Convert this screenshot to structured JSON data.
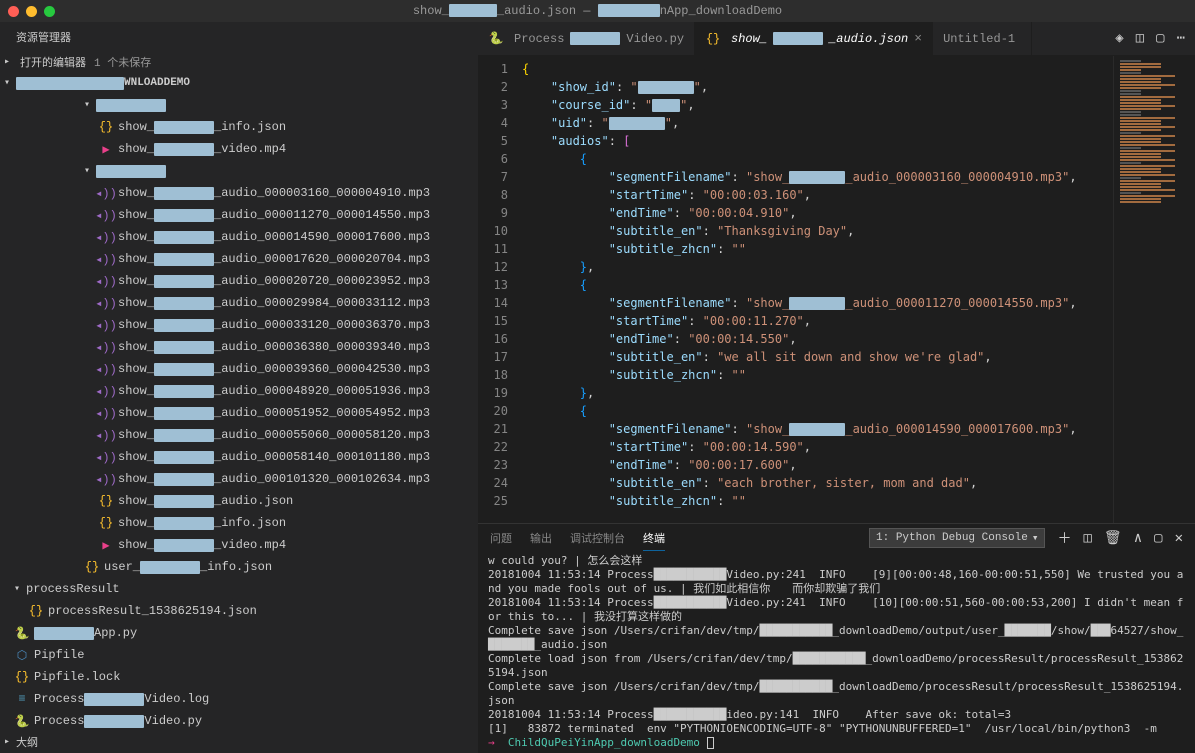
{
  "window": {
    "title_prefix": "show_",
    "title_mid": "_audio.json — ",
    "title_suffix": "nApp_downloadDemo"
  },
  "sidebar": {
    "title": "资源管理器",
    "open_editors_label": "打开的编辑器",
    "unsaved_count": "1 个未保存",
    "project_suffix": "WNLOADDEMO",
    "outline_label": "大纲"
  },
  "tree": {
    "items": [
      {
        "type": "folder",
        "indent": 1,
        "open": true,
        "label": ""
      },
      {
        "type": "file",
        "indent": 2,
        "icon": "json",
        "prefix": "show_",
        "suffix": "_info.json"
      },
      {
        "type": "file",
        "indent": 2,
        "icon": "video",
        "prefix": "show_",
        "suffix": "_video.mp4"
      },
      {
        "type": "folder",
        "indent": 1,
        "open": true,
        "label": ""
      },
      {
        "type": "file",
        "indent": 2,
        "icon": "audio",
        "prefix": "show_",
        "suffix": "_audio_000003160_000004910.mp3"
      },
      {
        "type": "file",
        "indent": 2,
        "icon": "audio",
        "prefix": "show_",
        "suffix": "_audio_000011270_000014550.mp3"
      },
      {
        "type": "file",
        "indent": 2,
        "icon": "audio",
        "prefix": "show_",
        "suffix": "_audio_000014590_000017600.mp3"
      },
      {
        "type": "file",
        "indent": 2,
        "icon": "audio",
        "prefix": "show_",
        "suffix": "_audio_000017620_000020704.mp3"
      },
      {
        "type": "file",
        "indent": 2,
        "icon": "audio",
        "prefix": "show_",
        "suffix": "_audio_000020720_000023952.mp3"
      },
      {
        "type": "file",
        "indent": 2,
        "icon": "audio",
        "prefix": "show_",
        "suffix": "_audio_000029984_000033112.mp3"
      },
      {
        "type": "file",
        "indent": 2,
        "icon": "audio",
        "prefix": "show_",
        "suffix": "_audio_000033120_000036370.mp3"
      },
      {
        "type": "file",
        "indent": 2,
        "icon": "audio",
        "prefix": "show_",
        "suffix": "_audio_000036380_000039340.mp3"
      },
      {
        "type": "file",
        "indent": 2,
        "icon": "audio",
        "prefix": "show_",
        "suffix": "_audio_000039360_000042530.mp3"
      },
      {
        "type": "file",
        "indent": 2,
        "icon": "audio",
        "prefix": "show_",
        "suffix": "_audio_000048920_000051936.mp3"
      },
      {
        "type": "file",
        "indent": 2,
        "icon": "audio",
        "prefix": "show_",
        "suffix": "_audio_000051952_000054952.mp3"
      },
      {
        "type": "file",
        "indent": 2,
        "icon": "audio",
        "prefix": "show_",
        "suffix": "_audio_000055060_000058120.mp3"
      },
      {
        "type": "file",
        "indent": 2,
        "icon": "audio",
        "prefix": "show_",
        "suffix": "_audio_000058140_000101180.mp3"
      },
      {
        "type": "file",
        "indent": 2,
        "icon": "audio",
        "prefix": "show_",
        "suffix": "_audio_000101320_000102634.mp3"
      },
      {
        "type": "file",
        "indent": 2,
        "icon": "json",
        "prefix": "show_",
        "suffix": "_audio.json"
      },
      {
        "type": "file",
        "indent": 2,
        "icon": "json",
        "prefix": "show_",
        "suffix": "_info.json"
      },
      {
        "type": "file",
        "indent": 2,
        "icon": "video",
        "prefix": "show_",
        "suffix": "_video.mp4"
      },
      {
        "type": "file",
        "indent": 1,
        "icon": "json",
        "prefix": "user_",
        "suffix": "_info.json"
      }
    ],
    "bottom": [
      {
        "type": "folder",
        "indent": 0,
        "open": true,
        "label": "processResult"
      },
      {
        "type": "file",
        "indent": 1,
        "icon": "json",
        "label": "processResult_1538625194.json"
      },
      {
        "type": "file",
        "indent": 0,
        "icon": "py",
        "suffix": "App.py",
        "redact": true
      },
      {
        "type": "file",
        "indent": 0,
        "icon": "pip",
        "label": "Pipfile"
      },
      {
        "type": "file",
        "indent": 0,
        "icon": "lock",
        "label": "Pipfile.lock"
      },
      {
        "type": "file",
        "indent": 0,
        "icon": "log",
        "prefix": "Process",
        "suffix": "Video.log",
        "redact": true
      },
      {
        "type": "file",
        "indent": 0,
        "icon": "py",
        "prefix": "Process",
        "suffix": "Video.py",
        "redact": true
      }
    ]
  },
  "tabs": [
    {
      "icon": "py",
      "prefix": "Process",
      "suffix": "Video.py",
      "active": false,
      "redact": true
    },
    {
      "icon": "json",
      "prefix": "show_",
      "suffix": "_audio.json",
      "active": true,
      "italic": true,
      "close": true,
      "redact": true
    },
    {
      "icon": "none",
      "label": "Untitled-1",
      "active": false,
      "modified": true
    }
  ],
  "code_lines": [
    {
      "n": 1,
      "html": "<span class='br'>{</span>"
    },
    {
      "n": 2,
      "html": "    <span class='k'>\"show_id\"</span><span class='p'>: </span><span class='s'>\"<span class='redact' style='width:56px'></span>\"</span><span class='p'>,</span>"
    },
    {
      "n": 3,
      "html": "    <span class='k'>\"course_id\"</span><span class='p'>: </span><span class='s'>\"<span class='redact' style='width:28px'></span>\"</span><span class='p'>,</span>"
    },
    {
      "n": 4,
      "html": "    <span class='k'>\"uid\"</span><span class='p'>: </span><span class='s'>\"<span class='redact' style='width:56px'></span>\"</span><span class='p'>,</span>"
    },
    {
      "n": 5,
      "html": "    <span class='k'>\"audios\"</span><span class='p'>: </span><span class='br2'>[</span>"
    },
    {
      "n": 6,
      "html": "        <span class='br3'>{</span>"
    },
    {
      "n": 7,
      "html": "            <span class='k'>\"segmentFilename\"</span><span class='p'>: </span><span class='s'>\"show_<span class='redact' style='width:56px'></span>_audio_000003160_000004910.mp3\"</span><span class='p'>,</span>"
    },
    {
      "n": 8,
      "html": "            <span class='k'>\"startTime\"</span><span class='p'>: </span><span class='s'>\"00:00:03.160\"</span><span class='p'>,</span>"
    },
    {
      "n": 9,
      "html": "            <span class='k'>\"endTime\"</span><span class='p'>: </span><span class='s'>\"00:00:04.910\"</span><span class='p'>,</span>"
    },
    {
      "n": 10,
      "html": "            <span class='k'>\"subtitle_en\"</span><span class='p'>: </span><span class='s'>\"Thanksgiving Day\"</span><span class='p'>,</span>"
    },
    {
      "n": 11,
      "html": "            <span class='k'>\"subtitle_zhcn\"</span><span class='p'>: </span><span class='s'>\"\"</span>"
    },
    {
      "n": 12,
      "html": "        <span class='br3'>}</span><span class='p'>,</span>"
    },
    {
      "n": 13,
      "html": "        <span class='br3'>{</span>"
    },
    {
      "n": 14,
      "html": "            <span class='k'>\"segmentFilename\"</span><span class='p'>: </span><span class='s'>\"show_<span class='redact' style='width:56px'></span>_audio_000011270_000014550.mp3\"</span><span class='p'>,</span>"
    },
    {
      "n": 15,
      "html": "            <span class='k'>\"startTime\"</span><span class='p'>: </span><span class='s'>\"00:00:11.270\"</span><span class='p'>,</span>"
    },
    {
      "n": 16,
      "html": "            <span class='k'>\"endTime\"</span><span class='p'>: </span><span class='s'>\"00:00:14.550\"</span><span class='p'>,</span>"
    },
    {
      "n": 17,
      "html": "            <span class='k'>\"subtitle_en\"</span><span class='p'>: </span><span class='s'>\"we all sit down and show we're glad\"</span><span class='p'>,</span>"
    },
    {
      "n": 18,
      "html": "            <span class='k'>\"subtitle_zhcn\"</span><span class='p'>: </span><span class='s'>\"\"</span>"
    },
    {
      "n": 19,
      "html": "        <span class='br3'>}</span><span class='p'>,</span>"
    },
    {
      "n": 20,
      "html": "        <span class='br3'>{</span>"
    },
    {
      "n": 21,
      "html": "            <span class='k'>\"segmentFilename\"</span><span class='p'>: </span><span class='s'>\"show_<span class='redact' style='width:56px'></span>_audio_000014590_000017600.mp3\"</span><span class='p'>,</span>"
    },
    {
      "n": 22,
      "html": "            <span class='k'>\"startTime\"</span><span class='p'>: </span><span class='s'>\"00:00:14.590\"</span><span class='p'>,</span>"
    },
    {
      "n": 23,
      "html": "            <span class='k'>\"endTime\"</span><span class='p'>: </span><span class='s'>\"00:00:17.600\"</span><span class='p'>,</span>"
    },
    {
      "n": 24,
      "html": "            <span class='k'>\"subtitle_en\"</span><span class='p'>: </span><span class='s'>\"each brother, sister, mom and dad\"</span><span class='p'>,</span>"
    },
    {
      "n": 25,
      "html": "            <span class='k'>\"subtitle_zhcn\"</span><span class='p'>: </span><span class='s'>\"\"</span>"
    }
  ],
  "panel": {
    "tabs": {
      "problems": "问题",
      "output": "输出",
      "debug": "调试控制台",
      "terminal": "终端"
    },
    "dropdown": "1: Python Debug Console",
    "terminal_lines": [
      "w could you? | 怎么会这样",
      "20181004 11:53:14 Process███████████Video.py:241  INFO    [9][00:00:48,160-00:00:51,550] We trusted you and you made fools out of us. | 我们如此相信你　　而你却欺骗了我们",
      "20181004 11:53:14 Process███████████Video.py:241  INFO    [10][00:00:51,560-00:00:53,200] I didn't mean for this to... | 我没打算这样做的",
      "Complete save json /Users/crifan/dev/tmp/███████████_downloadDemo/output/user_███████/show/███64527/show_███████_audio.json",
      "Complete load json from /Users/crifan/dev/tmp/███████████_downloadDemo/processResult/processResult_1538625194.json",
      "Complete save json /Users/crifan/dev/tmp/███████████_downloadDemo/processResult/processResult_1538625194.json",
      "20181004 11:53:14 Process███████████ideo.py:141  INFO    After save ok: total=3",
      "[1]   83872 terminated  env \"PYTHONIOENCODING=UTF-8\" \"PYTHONUNBUFFERED=1\"  /usr/local/bin/python3  -m"
    ],
    "prompt_arrow": "→ ",
    "prompt_path": "ChildQuPeiYinApp_downloadDemo"
  }
}
